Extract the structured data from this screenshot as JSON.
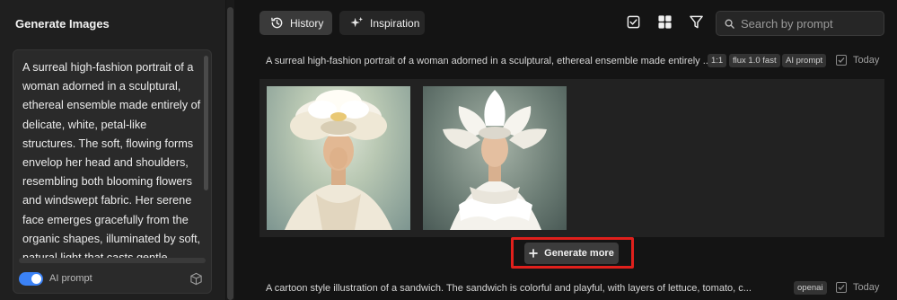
{
  "sidebar": {
    "title": "Generate Images",
    "prompt_text": "A surreal high-fashion portrait of a woman adorned in a sculptural, ethereal ensemble made entirely of delicate, white, petal-like structures. The soft, flowing forms envelop her head and shoulders, resembling both blooming flowers and windswept fabric. Her serene face emerges gracefully from the organic shapes, illuminated by soft, natural light that casts gentle shadows and highlights the",
    "ai_prompt_label": "AI prompt",
    "ai_prompt_enabled": true,
    "accent_color": "#3b82f6"
  },
  "toolbar": {
    "history_label": "History",
    "inspiration_label": "Inspiration",
    "search_placeholder": "Search by prompt",
    "icons": [
      "history-icon",
      "sparkle-icon",
      "select-checkbox-icon",
      "grid-view-icon",
      "filter-icon",
      "search-icon"
    ]
  },
  "entries": [
    {
      "prompt": "A surreal high-fashion portrait of a woman adorned in a sculptural, ethereal ensemble made entirely ...",
      "tags": [
        "1:1",
        "flux 1.0 fast",
        "AI prompt"
      ],
      "date": "Today",
      "image_count": 2
    },
    {
      "prompt": "A cartoon style illustration of a sandwich. The sandwich is colorful and playful, with layers of lettuce, tomato, c...",
      "tags": [
        "openai"
      ],
      "date": "Today"
    }
  ],
  "generate_more_label": "Generate more",
  "highlight_color": "#e0201c"
}
